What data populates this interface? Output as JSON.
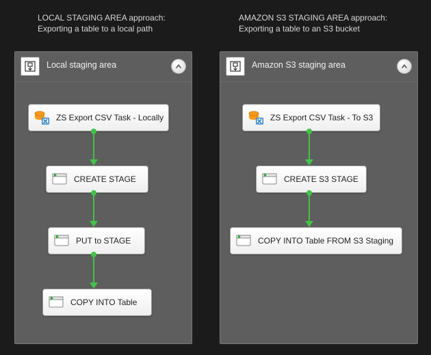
{
  "left": {
    "header_line1": "LOCAL STAGING AREA approach:",
    "header_line2": "Exporting a table to a local path",
    "panel_title": "Local staging area",
    "nodes": [
      {
        "label": "ZS Export CSV Task - Locally",
        "icon": "zs-export"
      },
      {
        "label": "CREATE STAGE",
        "icon": "sql-task"
      },
      {
        "label": "PUT to STAGE",
        "icon": "sql-task"
      },
      {
        "label": "COPY INTO Table",
        "icon": "sql-task"
      }
    ]
  },
  "right": {
    "header_line1": "AMAZON S3 STAGING AREA approach:",
    "header_line2": "Exporting a table to an S3 bucket",
    "panel_title": "Amazon S3 staging area",
    "nodes": [
      {
        "label": "ZS Export CSV Task - To S3",
        "icon": "zs-export"
      },
      {
        "label": "CREATE S3 STAGE",
        "icon": "sql-task"
      },
      {
        "label": "COPY INTO Table FROM S3 Staging",
        "icon": "sql-task"
      }
    ]
  },
  "chart_data": {
    "type": "diagram",
    "title": "Comparison of two Snowflake staging approaches",
    "panels": [
      {
        "name": "Local staging area",
        "heading": "LOCAL STAGING AREA approach: Exporting a table to a local path",
        "flow": [
          "ZS Export CSV Task - Locally",
          "CREATE STAGE",
          "PUT to STAGE",
          "COPY INTO Table"
        ]
      },
      {
        "name": "Amazon S3 staging area",
        "heading": "AMAZON S3 STAGING AREA approach: Exporting a table to an S3 bucket",
        "flow": [
          "ZS Export CSV Task - To S3",
          "CREATE S3 STAGE",
          "COPY INTO Table FROM S3 Staging"
        ]
      }
    ]
  }
}
